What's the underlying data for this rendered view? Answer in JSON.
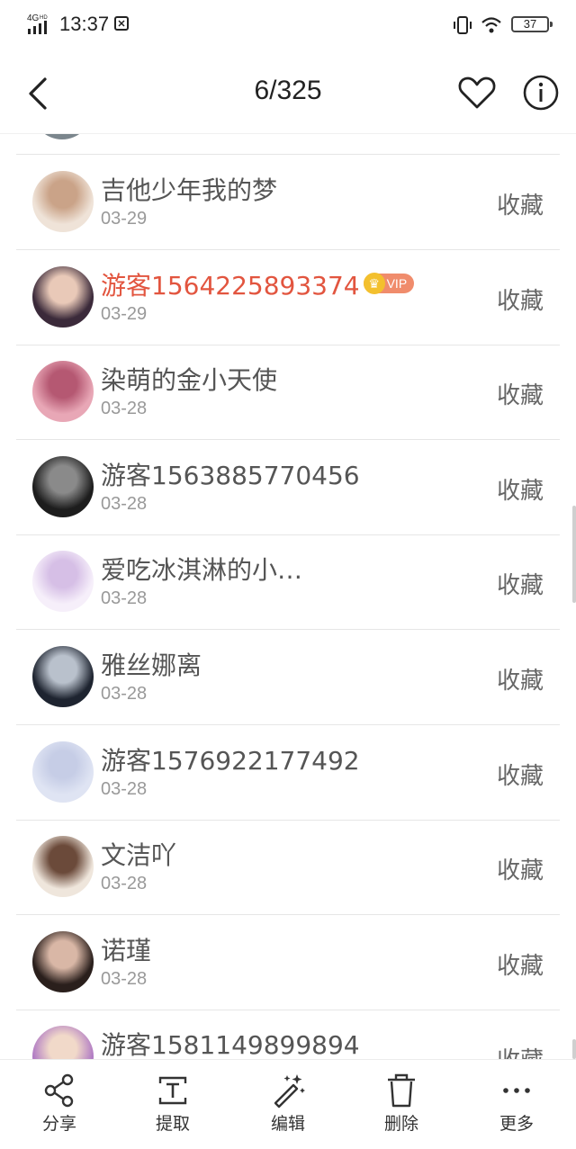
{
  "status_bar": {
    "network": "4G HD",
    "time": "13:37",
    "battery": "37"
  },
  "nav": {
    "page_counter": "6/325"
  },
  "list": [
    {
      "name": "吉他少年我的梦",
      "date": "03-29",
      "action": "收藏",
      "vip": false,
      "avatar_colors": [
        "#efe3d8",
        "#caa388"
      ]
    },
    {
      "name": "游客1564225893374",
      "date": "03-29",
      "action": "收藏",
      "vip": true,
      "vip_label": "VIP",
      "avatar_colors": [
        "#3b2a3a",
        "#e9c9b8"
      ]
    },
    {
      "name": "染萌的金小天使",
      "date": "03-28",
      "action": "收藏",
      "vip": false,
      "avatar_colors": [
        "#e8a7b6",
        "#b55872"
      ]
    },
    {
      "name": "游客1563885770456",
      "date": "03-28",
      "action": "收藏",
      "vip": false,
      "avatar_colors": [
        "#1d1d1d",
        "#8a8a8a"
      ]
    },
    {
      "name": "爱吃冰淇淋的小…",
      "date": "03-28",
      "action": "收藏",
      "vip": false,
      "avatar_colors": [
        "#f6effa",
        "#d6bfe6"
      ]
    },
    {
      "name": "雅丝娜离",
      "date": "03-28",
      "action": "收藏",
      "vip": false,
      "avatar_colors": [
        "#1e2430",
        "#b9c1cc"
      ]
    },
    {
      "name": "游客1576922177492",
      "date": "03-28",
      "action": "收藏",
      "vip": false,
      "avatar_colors": [
        "#dfe4f3",
        "#c6cde6"
      ]
    },
    {
      "name": "文洁吖",
      "date": "03-28",
      "action": "收藏",
      "vip": false,
      "avatar_colors": [
        "#efe6dc",
        "#6b4a3a"
      ]
    },
    {
      "name": "诺瑾",
      "date": "03-28",
      "action": "收藏",
      "vip": false,
      "avatar_colors": [
        "#2a1f1c",
        "#d9b7a6"
      ]
    },
    {
      "name": "游客1581149899894",
      "date": "",
      "action": "收藏",
      "vip": false,
      "avatar_colors": [
        "#b27dc4",
        "#f1d9c9"
      ]
    }
  ],
  "toolbar": {
    "share": "分享",
    "extract": "提取",
    "edit": "编辑",
    "delete": "删除",
    "more": "更多"
  },
  "icons": {
    "back": "chevron-left-icon",
    "favorite": "heart-icon",
    "info": "info-icon",
    "share": "share-icon",
    "extract": "text-extract-icon",
    "edit": "magic-wand-icon",
    "delete": "trash-icon",
    "more": "more-dots-icon"
  }
}
